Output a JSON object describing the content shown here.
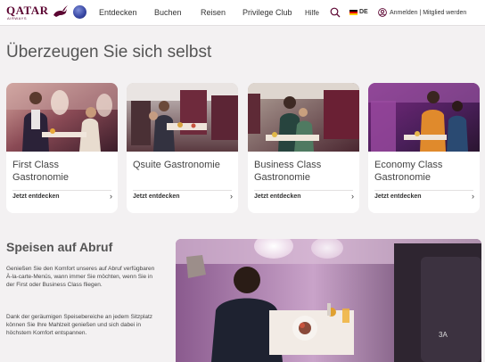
{
  "brand": {
    "logo_text": "QATAR",
    "logo_sub": "AIRWAYS"
  },
  "nav": [
    "Entdecken",
    "Buchen",
    "Reisen",
    "Privilege Club"
  ],
  "header": {
    "help": "Hilfe",
    "language": "DE",
    "login": "Anmelden | Mitglied werden"
  },
  "page": {
    "title": "Überzeugen Sie sich selbst"
  },
  "cards": [
    {
      "title": "First Class Gastronomie",
      "link": "Jetzt entdecken"
    },
    {
      "title": "Qsuite Gastronomie",
      "link": "Jetzt entdecken"
    },
    {
      "title": "Business Class Gastronomie",
      "link": "Jetzt entdecken"
    },
    {
      "title": "Economy Class Gastronomie",
      "link": "Jetzt entdecken"
    }
  ],
  "section": {
    "title": "Speisen auf Abruf",
    "paragraphs": [
      "Genießen Sie den Komfort unseres auf Abruf verfügbaren À-la-carte-Menüs, wann immer Sie möchten, wenn Sie in der First oder Business Class fliegen.",
      "Dank der geräumigen Speisebereiche an jedem Sitzplatz können Sie Ihre Mahlzeit genießen und sich dabei in höchstem Komfort entspannen."
    ]
  },
  "colors": {
    "brand": "#5c0632",
    "background": "#f3f1f2"
  },
  "icons": [
    "oryx-icon",
    "oneworld-icon",
    "search-icon",
    "flag-de-icon",
    "user-icon",
    "chevron-right-icon"
  ]
}
